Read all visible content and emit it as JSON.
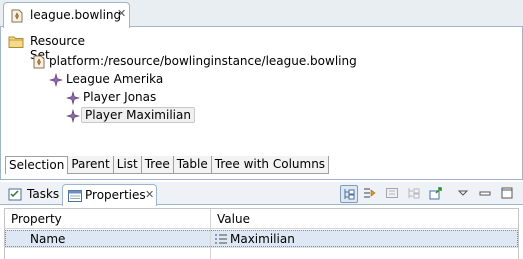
{
  "editor": {
    "tab_label": "league.bowling",
    "resource_set_label": "Resource Set",
    "tree": [
      {
        "label": "platform:/resource/bowlinginstance/league.bowling",
        "icon": "bowling-file-icon",
        "depth": 1
      },
      {
        "label": "League Amerika",
        "icon": "emf-object-icon",
        "depth": 2
      },
      {
        "label": "Player Jonas",
        "icon": "emf-object-icon",
        "depth": 3
      },
      {
        "label": "Player Maximilian",
        "icon": "emf-object-icon",
        "depth": 3,
        "selected": true
      }
    ],
    "subtabs": [
      "Selection",
      "Parent",
      "List",
      "Tree",
      "Table",
      "Tree with Columns"
    ],
    "active_subtab": "Selection"
  },
  "bottom": {
    "tabs": [
      {
        "label": "Tasks",
        "icon": "tasks-icon"
      },
      {
        "label": "Properties",
        "icon": "properties-icon",
        "active": true
      }
    ],
    "toolbar_icons": [
      "show-categories-icon",
      "show-advanced-icon",
      "filter-icon",
      "restore-default-icon",
      "pin-icon",
      "view-menu-icon",
      "minimize-icon",
      "maximize-icon"
    ],
    "table": {
      "columns": [
        "Property",
        "Value"
      ],
      "rows": [
        {
          "property": "Name",
          "value": "Maximilian",
          "value_icon": "text-field-icon"
        }
      ]
    }
  },
  "colors": {
    "accent": "#9eb5cc",
    "selection": "#dde8f4",
    "object_icon": "#7a5a8c"
  }
}
